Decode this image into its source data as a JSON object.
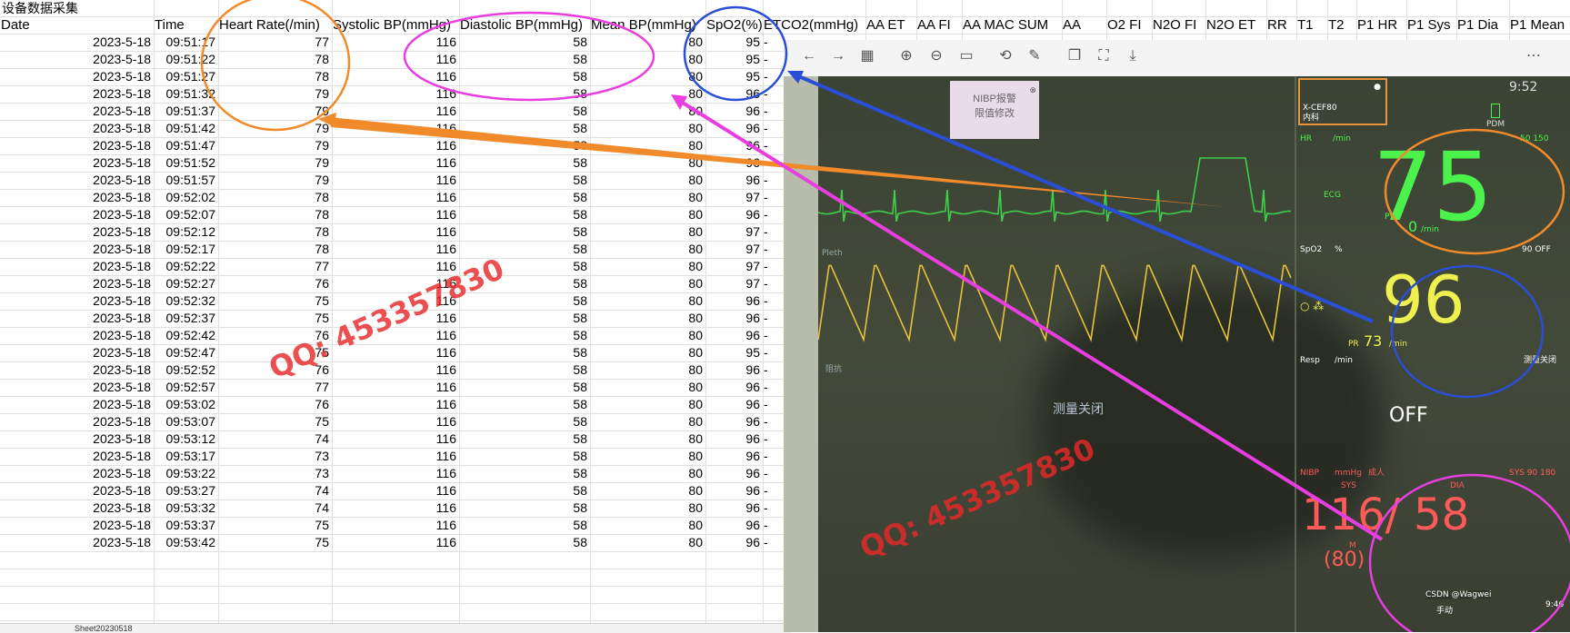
{
  "sheet": {
    "title": "设备数据采集",
    "columns": [
      "Date",
      "Time",
      "Heart Rate(/min)",
      "Systolic BP(mmHg)",
      "Diastolic BP(mmHg)",
      "Mean BP(mmHg)",
      "SpO2(%)",
      "ETCO2(mmHg)",
      "AA ET",
      "AA FI",
      "AA MAC SUM",
      "AA",
      "O2 FI",
      "N2O FI",
      "N2O ET",
      "RR",
      "T1",
      "T2",
      "P1 HR",
      "P1 Sys",
      "P1 Dia",
      "P1 Mean"
    ],
    "rows": [
      [
        "2023-5-18",
        "09:51:17",
        "77",
        "116",
        "58",
        "80",
        "95",
        "-"
      ],
      [
        "2023-5-18",
        "09:51:22",
        "78",
        "116",
        "58",
        "80",
        "95",
        "-"
      ],
      [
        "2023-5-18",
        "09:51:27",
        "78",
        "116",
        "58",
        "80",
        "95",
        "-"
      ],
      [
        "2023-5-18",
        "09:51:32",
        "79",
        "116",
        "58",
        "80",
        "96",
        "-"
      ],
      [
        "2023-5-18",
        "09:51:37",
        "79",
        "116",
        "58",
        "80",
        "96",
        "-"
      ],
      [
        "2023-5-18",
        "09:51:42",
        "79",
        "116",
        "58",
        "80",
        "96",
        "-"
      ],
      [
        "2023-5-18",
        "09:51:47",
        "79",
        "116",
        "58",
        "80",
        "96",
        "-"
      ],
      [
        "2023-5-18",
        "09:51:52",
        "79",
        "116",
        "58",
        "80",
        "96",
        "-"
      ],
      [
        "2023-5-18",
        "09:51:57",
        "79",
        "116",
        "58",
        "80",
        "96",
        "-"
      ],
      [
        "2023-5-18",
        "09:52:02",
        "78",
        "116",
        "58",
        "80",
        "97",
        "-"
      ],
      [
        "2023-5-18",
        "09:52:07",
        "78",
        "116",
        "58",
        "80",
        "96",
        "-"
      ],
      [
        "2023-5-18",
        "09:52:12",
        "78",
        "116",
        "58",
        "80",
        "97",
        "-"
      ],
      [
        "2023-5-18",
        "09:52:17",
        "78",
        "116",
        "58",
        "80",
        "97",
        "-"
      ],
      [
        "2023-5-18",
        "09:52:22",
        "77",
        "116",
        "58",
        "80",
        "97",
        "-"
      ],
      [
        "2023-5-18",
        "09:52:27",
        "76",
        "116",
        "58",
        "80",
        "97",
        "-"
      ],
      [
        "2023-5-18",
        "09:52:32",
        "75",
        "116",
        "58",
        "80",
        "96",
        "-"
      ],
      [
        "2023-5-18",
        "09:52:37",
        "75",
        "116",
        "58",
        "80",
        "96",
        "-"
      ],
      [
        "2023-5-18",
        "09:52:42",
        "76",
        "116",
        "58",
        "80",
        "96",
        "-"
      ],
      [
        "2023-5-18",
        "09:52:47",
        "75",
        "116",
        "58",
        "80",
        "95",
        "-"
      ],
      [
        "2023-5-18",
        "09:52:52",
        "76",
        "116",
        "58",
        "80",
        "96",
        "-"
      ],
      [
        "2023-5-18",
        "09:52:57",
        "77",
        "116",
        "58",
        "80",
        "96",
        "-"
      ],
      [
        "2023-5-18",
        "09:53:02",
        "76",
        "116",
        "58",
        "80",
        "96",
        "-"
      ],
      [
        "2023-5-18",
        "09:53:07",
        "75",
        "116",
        "58",
        "80",
        "96",
        "-"
      ],
      [
        "2023-5-18",
        "09:53:12",
        "74",
        "116",
        "58",
        "80",
        "96",
        "-"
      ],
      [
        "2023-5-18",
        "09:53:17",
        "73",
        "116",
        "58",
        "80",
        "96",
        "-"
      ],
      [
        "2023-5-18",
        "09:53:22",
        "73",
        "116",
        "58",
        "80",
        "96",
        "-"
      ],
      [
        "2023-5-18",
        "09:53:27",
        "74",
        "116",
        "58",
        "80",
        "96",
        "-"
      ],
      [
        "2023-5-18",
        "09:53:32",
        "74",
        "116",
        "58",
        "80",
        "96",
        "-"
      ],
      [
        "2023-5-18",
        "09:53:37",
        "75",
        "116",
        "58",
        "80",
        "96",
        "-"
      ],
      [
        "2023-5-18",
        "09:53:42",
        "75",
        "116",
        "58",
        "80",
        "96",
        "-"
      ]
    ],
    "sheet_tab_label": "Sheet20230518"
  },
  "viewer": {
    "toolbar_icons": [
      "back-arrow-icon",
      "forward-arrow-icon",
      "grid-icon",
      "zoom-in-icon",
      "zoom-out-icon",
      "actual-size-icon",
      "rotate-icon",
      "edit-icon",
      "copy-icon",
      "crop-icon",
      "download-icon",
      "more-icon"
    ]
  },
  "monitor": {
    "sticky_note": "NIBP报警\n限值修改",
    "patient_id": "X-CEF80",
    "department": "内科",
    "time": "9:52",
    "pdm_label": "PDM",
    "hr_label": "HR",
    "hr_unit": "/min",
    "hr_limits": "50 150",
    "hr_value": "75",
    "ecg_label": "ECG",
    "pvc_label": "PVC",
    "pvc_value": "0",
    "pvc_unit": "/min",
    "spo2_label": "SpO2",
    "spo2_unit": "%",
    "spo2_limits": "90 OFF",
    "spo2_value": "96",
    "pr_label": "PR",
    "pr_value": "73",
    "pr_unit": "/min",
    "resp_label": "Resp",
    "resp_unit": "/min",
    "resp_status": "测量关闭",
    "resp_value": "OFF",
    "center_msg": "测量关闭",
    "wave_label_pleth": "Pleth",
    "wave_label_resp": "阻抗",
    "nibp_label": "NIBP",
    "nibp_unit": "mmHg",
    "nibp_mode": "成人",
    "nibp_limits": "SYS 90 180",
    "sys_label": "SYS",
    "dia_label": "DIA",
    "nibp_value": "116/ 58",
    "mean_label": "M",
    "mean_value": "(80)",
    "manual_label": "手动",
    "nibp_time": "9:46"
  },
  "watermarks": [
    "QQ: 453357830",
    "QQ: 453357830"
  ],
  "credit": "CSDN @Wagwei",
  "colors": {
    "orange": "#f08a2a",
    "blue": "#2a4fd6",
    "magenta": "#e83ee0",
    "hr_green": "#4cf24c",
    "spo2_yellow": "#eef050",
    "nibp_red": "#ff5a5a"
  }
}
